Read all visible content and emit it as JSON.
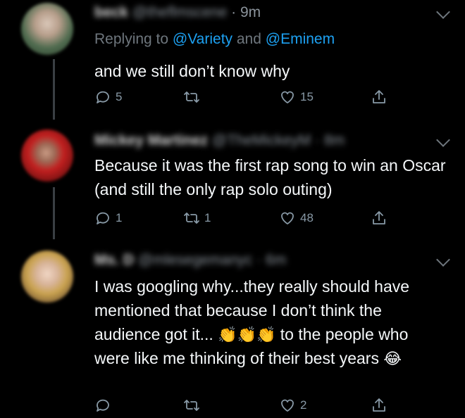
{
  "tweets": [
    {
      "name": "beck",
      "handle": "@theflmscene",
      "time": "9m",
      "replying_prefix": "Replying to ",
      "mention1": "@Variety",
      "and_word": " and ",
      "mention2": "@Eminem",
      "text": "and we still don’t know why",
      "reply_count": "5",
      "retweet_count": "",
      "like_count": "15"
    },
    {
      "name": "Mickey Martinez",
      "handle": "@TheMickeyM",
      "time": "8m",
      "text": "Because it was the first rap song to win an Oscar (and still the only rap solo outing)",
      "reply_count": "1",
      "retweet_count": "1",
      "like_count": "48"
    },
    {
      "name": "Ms. D",
      "handle": "@mlesegemanyc",
      "time": "6m",
      "text_line1": "I was googling why...they really should have mentioned that because I don’t think the audience got it...",
      "clap_emoji": "👏",
      "text_line2": "to the people who were like me thinking of their best years",
      "laugh_emoji": "😂",
      "reply_count": "",
      "retweet_count": "",
      "like_count": "2"
    }
  ],
  "icons": {
    "reply": "reply-icon",
    "retweet": "retweet-icon",
    "like": "heart-icon",
    "share": "share-icon",
    "more": "chevron-down-icon"
  },
  "colors": {
    "background": "#000000",
    "mention": "#1da1f2",
    "muted": "#6e767d"
  }
}
